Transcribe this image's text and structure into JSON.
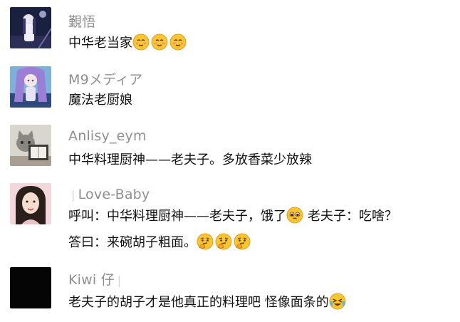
{
  "comments": [
    {
      "name": "覲悟",
      "lines": [
        "中华老当家"
      ],
      "avatar_icon": "anime-girl-night-avatar",
      "emoji_icon": "smiling-face-emoji"
    },
    {
      "name": "M9メディア",
      "lines": [
        "魔法老厨娘"
      ],
      "avatar_icon": "anime-purple-hair-avatar"
    },
    {
      "name": "Anlisy_eym",
      "lines": [
        "中华料理厨神——老夫子。多放香菜少放辣"
      ],
      "avatar_icon": "cat-reading-book-avatar"
    },
    {
      "name_prefix": "❘",
      "name": "Love-Baby",
      "lines": [
        "呼叫：中华料理厨神——老夫子，饿了",
        "老夫子：吃啥？",
        "答曰：来碗胡子粗面。"
      ],
      "avatar_icon": "woman-portrait-avatar",
      "emoji_icons": [
        "pleading-face-emoji",
        "thinking-face-emoji"
      ]
    },
    {
      "name": "Kiwi 仔",
      "name_suffix": "❘",
      "lines": [
        "老夫子的胡子才是他真正的料理吧 怪像面条的"
      ],
      "avatar_icon": "black-avatar",
      "emoji_icon": "crying-laughing-emoji"
    }
  ]
}
